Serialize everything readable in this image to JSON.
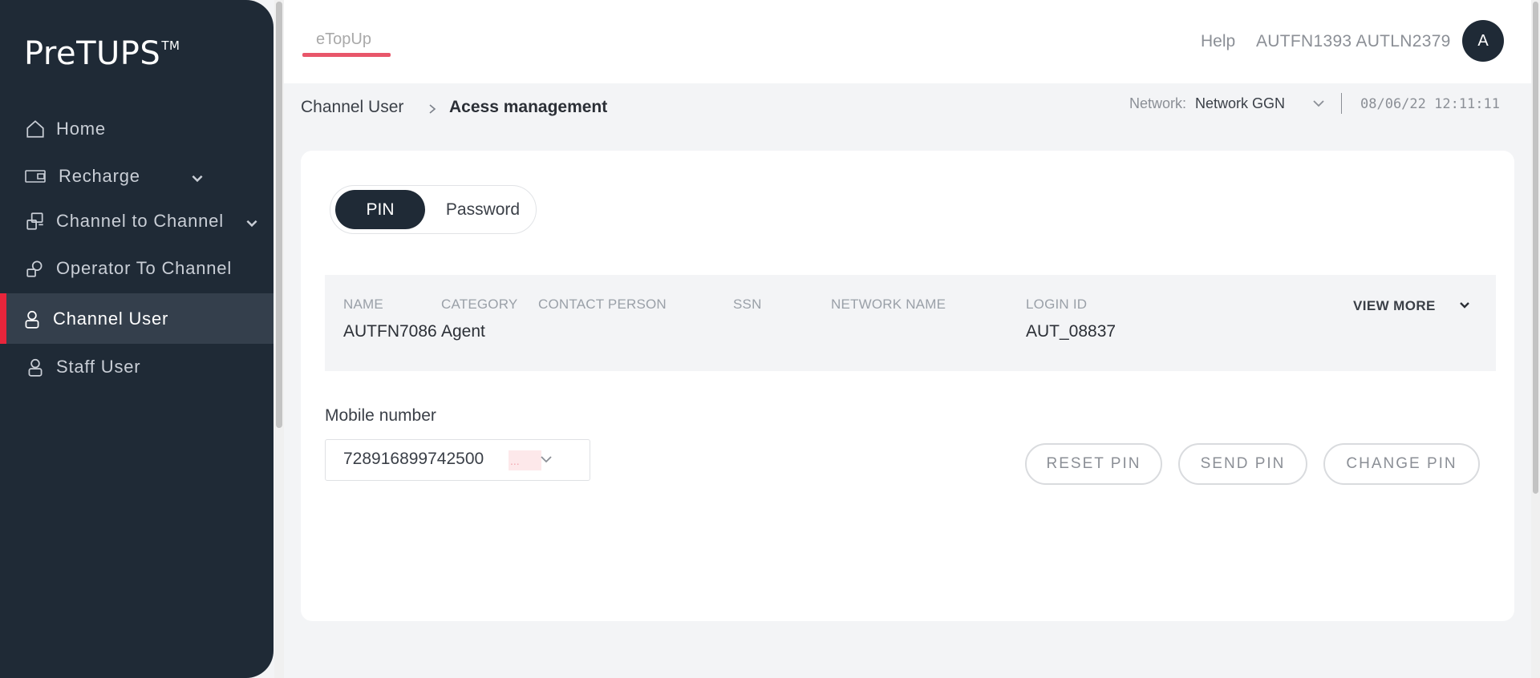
{
  "app": {
    "brand": "PreTUPS",
    "brand_tm": "TM"
  },
  "sidebar": {
    "items": [
      {
        "label": "Home",
        "icon": "home-icon",
        "active": false
      },
      {
        "label": "Recharge",
        "icon": "recharge-icon",
        "active": false,
        "expandable": true
      },
      {
        "label": "Channel to Channel",
        "icon": "channel-to-channel-icon",
        "active": false,
        "expandable": true
      },
      {
        "label": "Operator To Channel",
        "icon": "operator-to-channel-icon",
        "active": false
      },
      {
        "label": "Channel User",
        "icon": "user-icon",
        "active": true
      },
      {
        "label": "Staff User",
        "icon": "user-icon",
        "active": false
      }
    ],
    "accent_color": "#e8253b"
  },
  "topbar": {
    "tab": "eTopUp",
    "help": "Help",
    "username": "AUTFN1393 AUTLN2379",
    "avatar_initial": "A"
  },
  "breadcrumb": {
    "root": "Channel User",
    "current": "Acess management"
  },
  "network": {
    "label": "Network:",
    "value": "Network GGN",
    "datetime": "08/06/22 12:11:11"
  },
  "toggle": {
    "options": [
      "PIN",
      "Password"
    ],
    "selected": "PIN"
  },
  "info": {
    "headers": {
      "name": "NAME",
      "category": "CATEGORY",
      "contact_person": "CONTACT PERSON",
      "ssn": "SSN",
      "network_name": "NETWORK NAME",
      "login_id": "LOGIN ID"
    },
    "values": {
      "name": "AUTFN7086",
      "category": "Agent",
      "contact_person": "",
      "ssn": "",
      "network_name": "",
      "login_id": "AUT_08837"
    },
    "view_more": "VIEW MORE"
  },
  "mobile": {
    "label": "Mobile number",
    "value": "728916899742500",
    "badge": "..."
  },
  "actions": {
    "reset_pin": "RESET PIN",
    "send_pin": "SEND PIN",
    "change_pin": "CHANGE PIN"
  }
}
